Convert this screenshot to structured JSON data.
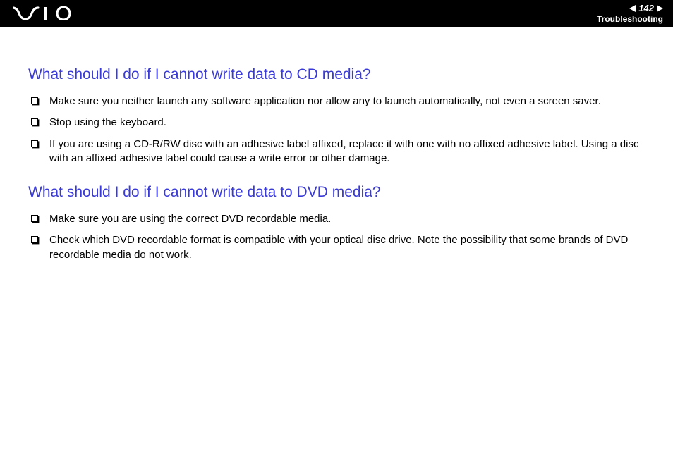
{
  "header": {
    "page_number": "142",
    "section_label": "Troubleshooting"
  },
  "content": {
    "section1": {
      "heading": "What should I do if I cannot write data to CD media?",
      "bullets": [
        "Make sure you neither launch any software application nor allow any to launch automatically, not even a screen saver.",
        "Stop using the keyboard.",
        "If you are using a CD-R/RW disc with an adhesive label affixed, replace it with one with no affixed adhesive label. Using a disc with an affixed adhesive label could cause a write error or other damage."
      ]
    },
    "section2": {
      "heading": "What should I do if I cannot write data to DVD media?",
      "bullets": [
        "Make sure you are using the correct DVD recordable media.",
        "Check which DVD recordable format is compatible with your optical disc drive. Note the possibility that some brands of DVD recordable media do not work."
      ]
    }
  }
}
